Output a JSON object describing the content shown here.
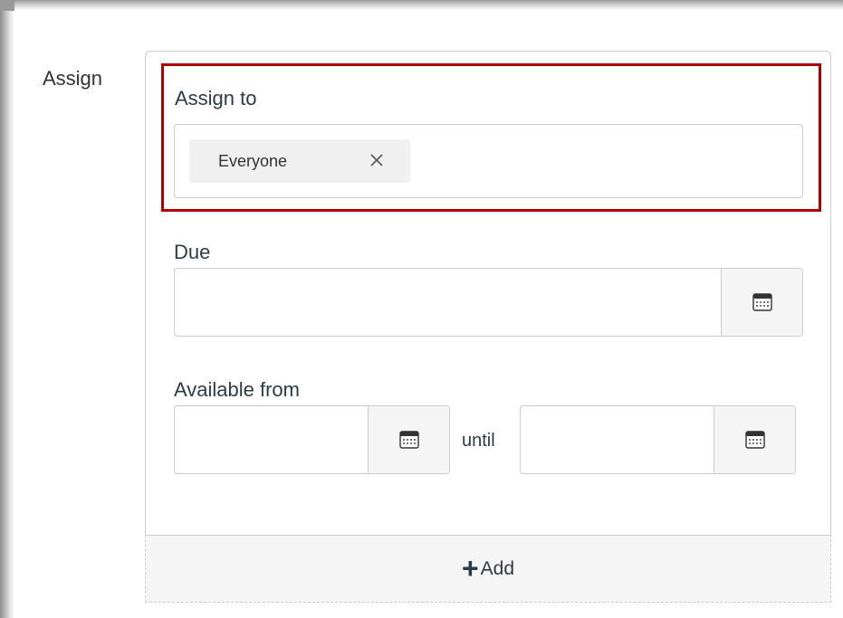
{
  "section": {
    "label": "Assign"
  },
  "assign_to": {
    "label": "Assign to",
    "tokens": [
      {
        "text": "Everyone",
        "remove_icon": "close-icon"
      }
    ]
  },
  "due": {
    "label": "Due",
    "value": "",
    "button_icon": "calendar-icon"
  },
  "available": {
    "from_label": "Available from",
    "from_value": "",
    "until_label": "until",
    "until_value": "",
    "button_icon": "calendar-icon"
  },
  "add_button": {
    "icon": "+",
    "label": "Add"
  },
  "colors": {
    "highlight": "#b00000",
    "border": "#c7cdd1",
    "button_bg": "#f5f5f5",
    "token_bg": "#f0f0f0",
    "text": "#2d3b45"
  }
}
